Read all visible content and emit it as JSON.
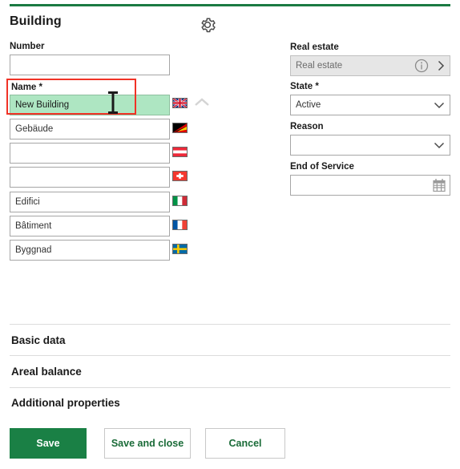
{
  "theme": {
    "accent_green": "#1a7a42",
    "primary_button_green": "#1a8045",
    "highlight_field_green": "#aee6c2",
    "annotation_red": "#f03226"
  },
  "header": {
    "title": "Building",
    "settings_icon": "gear-icon"
  },
  "left_panel": {
    "number_field": {
      "label": "Number",
      "value": "",
      "placeholder": ""
    },
    "name_field": {
      "label": "Name *",
      "value": "New Building",
      "placeholder": "",
      "focused": true,
      "flag": "flag-uk",
      "flag_title": "English",
      "collapse_icon": "chevron-up-icon"
    },
    "translations": [
      {
        "value": "Gebäude",
        "flag": "flag-de",
        "flag_title": "German",
        "placeholder": ""
      },
      {
        "value": "",
        "flag": "flag-at",
        "flag_title": "Austrian",
        "placeholder": ""
      },
      {
        "value": "",
        "flag": "flag-ch",
        "flag_title": "Swiss",
        "placeholder": ""
      },
      {
        "value": "Edifici",
        "flag": "flag-it",
        "flag_title": "Italian",
        "placeholder": ""
      },
      {
        "value": "Bâtiment",
        "flag": "flag-fr",
        "flag_title": "French",
        "placeholder": ""
      },
      {
        "value": "Byggnad",
        "flag": "flag-se",
        "flag_title": "Swedish",
        "placeholder": ""
      }
    ]
  },
  "right_panel": {
    "real_estate": {
      "label": "Real estate",
      "value": "Real estate",
      "placeholder": "Real estate",
      "readonly": true,
      "info_icon": "info-icon",
      "open_icon": "chevron-right-icon"
    },
    "state": {
      "label": "State *",
      "value": "Active",
      "placeholder": "",
      "dropdown_icon": "chevron-down-icon",
      "options": [
        "Active"
      ]
    },
    "reason": {
      "label": "Reason",
      "value": "",
      "placeholder": "",
      "dropdown_icon": "chevron-down-icon",
      "options": []
    },
    "end_of_service": {
      "label": "End of Service",
      "value": "",
      "placeholder": "",
      "calendar_icon": "calendar-icon"
    }
  },
  "sections": [
    {
      "title": "Basic data"
    },
    {
      "title": "Areal balance"
    },
    {
      "title": "Additional properties"
    }
  ],
  "footer": {
    "save": "Save",
    "save_and_close": "Save and close",
    "cancel": "Cancel"
  }
}
